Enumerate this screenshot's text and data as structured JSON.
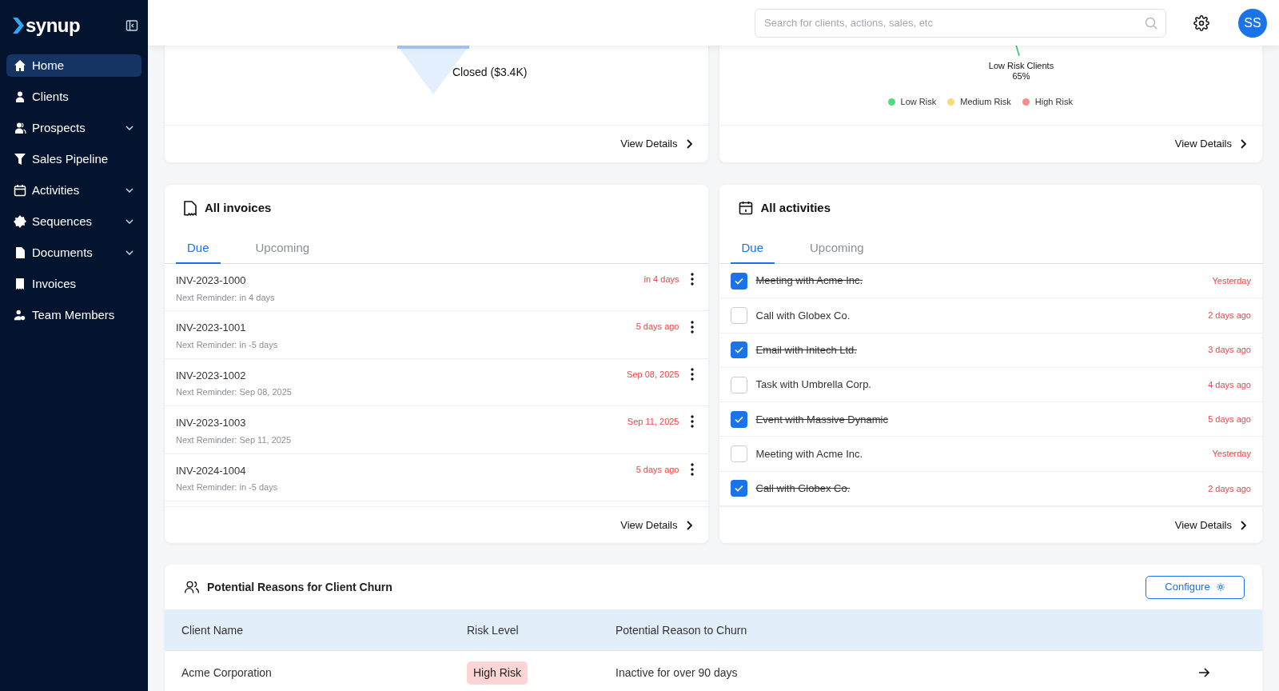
{
  "sidebar": {
    "logo": "synup",
    "items": [
      {
        "label": "Home",
        "selected": true,
        "has_submenu": false
      },
      {
        "label": "Clients",
        "selected": false,
        "has_submenu": false
      },
      {
        "label": "Prospects",
        "selected": false,
        "has_submenu": true
      },
      {
        "label": "Sales Pipeline",
        "selected": false,
        "has_submenu": false
      },
      {
        "label": "Activities",
        "selected": false,
        "has_submenu": true
      },
      {
        "label": "Sequences",
        "selected": false,
        "has_submenu": true
      },
      {
        "label": "Documents",
        "selected": false,
        "has_submenu": true
      },
      {
        "label": "Invoices",
        "selected": false,
        "has_submenu": false
      },
      {
        "label": "Team Members",
        "selected": false,
        "has_submenu": false
      }
    ]
  },
  "header": {
    "search_placeholder": "Search for clients, actions, sales, etc",
    "avatar": "SS"
  },
  "funnel_card": {
    "stage_label": "Closed ($3.4K)",
    "link": "View Details"
  },
  "risk_card": {
    "slice_label": "Low Risk Clients",
    "slice_value": "65%",
    "legend": [
      {
        "label": "Low Risk",
        "color": "#4ade80"
      },
      {
        "label": "Medium Risk",
        "color": "#fcd97d"
      },
      {
        "label": "High Risk",
        "color": "#f98b8b"
      }
    ],
    "link": "View Details"
  },
  "invoices": {
    "title": "All invoices",
    "tabs": [
      {
        "label": "Due",
        "selected": true
      },
      {
        "label": "Upcoming",
        "selected": false
      }
    ],
    "rows": [
      {
        "id": "INV-2023-1000",
        "reminder": "Next Reminder: in 4 days",
        "due": "in 4 days"
      },
      {
        "id": "INV-2023-1001",
        "reminder": "Next Reminder: in -5 days",
        "due": "5 days ago"
      },
      {
        "id": "INV-2023-1002",
        "reminder": "Next Reminder: Sep 08, 2025",
        "due": "Sep 08, 2025"
      },
      {
        "id": "INV-2023-1003",
        "reminder": "Next Reminder: Sep 11, 2025",
        "due": "Sep 11, 2025"
      },
      {
        "id": "INV-2024-1004",
        "reminder": "Next Reminder: in -5 days",
        "due": "5 days ago"
      }
    ],
    "link": "View Details"
  },
  "activities": {
    "title": "All activities",
    "tabs": [
      {
        "label": "Due",
        "selected": true
      },
      {
        "label": "Upcoming",
        "selected": false
      }
    ],
    "rows": [
      {
        "label": "Meeting with Acme Inc.",
        "checked": true,
        "when": "Yesterday"
      },
      {
        "label": "Call with Globex Co.",
        "checked": false,
        "when": "2 days ago"
      },
      {
        "label": "Email with Initech Ltd.",
        "checked": true,
        "when": "3 days ago"
      },
      {
        "label": "Task with Umbrella Corp.",
        "checked": false,
        "when": "4 days ago"
      },
      {
        "label": "Event with Massive Dynamic",
        "checked": true,
        "when": "5 days ago"
      },
      {
        "label": "Meeting with Acme Inc.",
        "checked": false,
        "when": "Yesterday"
      },
      {
        "label": "Call with Globex Co.",
        "checked": true,
        "when": "2 days ago"
      }
    ],
    "link": "View Details"
  },
  "churn": {
    "title": "Potential Reasons for Client Churn",
    "button": "Configure",
    "columns": [
      "Client Name",
      "Risk Level",
      "Potential Reason to Churn"
    ],
    "rows": [
      {
        "client": "Acme Corporation",
        "risk": "High Risk",
        "reason": "Inactive for over 90 days"
      }
    ]
  }
}
